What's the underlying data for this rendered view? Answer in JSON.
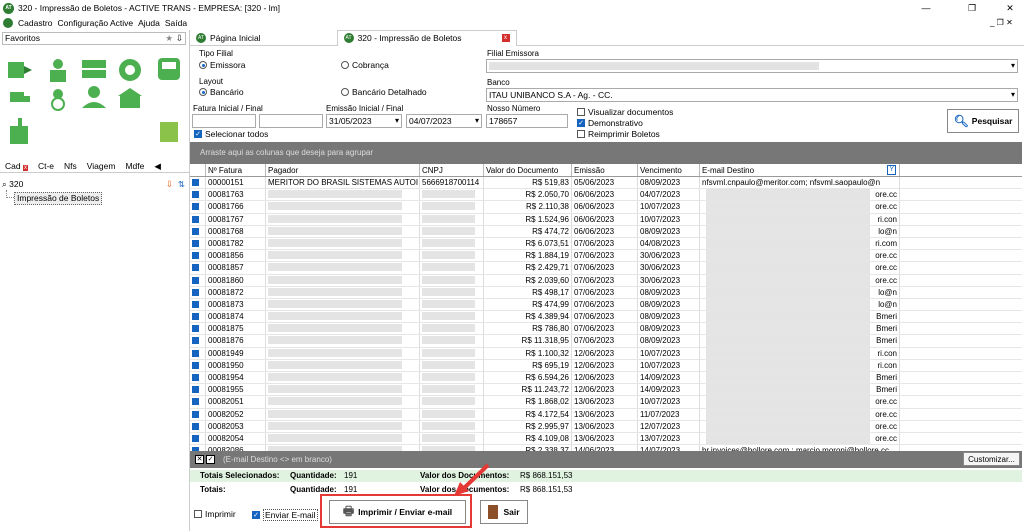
{
  "window": {
    "title": "320 - Impressão de Boletos - ACTIVE TRANS - EMPRESA: [320 - lm]",
    "logo": "AT"
  },
  "menu": [
    "Cadastro",
    "Configuração Active",
    "Ajuda",
    "Saída"
  ],
  "left": {
    "favorites_label": "Favoritos",
    "tabs": [
      "Cad",
      "Ct-e",
      "Nfs",
      "Viagem",
      "Mdfe"
    ],
    "search_value": "320",
    "tree_item": "Impressão de Boletos"
  },
  "tabs": [
    {
      "label": "Página Inicial"
    },
    {
      "label": "320 - Impressão de Boletos"
    }
  ],
  "form": {
    "tipo_filial_label": "Tipo Filial",
    "emissora": "Emissora",
    "cobranca": "Cobrança",
    "layout_label": "Layout",
    "bancario": "Bancário",
    "bancario_detalhado": "Bancário Detalhado",
    "filial_emissora_label": "Filial Emissora",
    "banco_label": "Banco",
    "banco_value": "ITAU UNIBANCO S.A - Ag.        - CC.",
    "fatura_label": "Fatura Inicial / Final",
    "emissao_label": "Emissão Inicial / Final",
    "emissao_inicial": "31/05/2023",
    "emissao_final": "04/07/2023",
    "nosso_numero_label": "Nosso Número",
    "nosso_numero": "178657",
    "visualizar": "Visualizar documentos",
    "demonstrativo": "Demonstrativo",
    "reimprimir": "Reimprimir Boletos",
    "selecionar_todos": "Selecionar todos",
    "pesquisar": "Pesquisar"
  },
  "grid": {
    "group_hint": "Arraste aqui as colunas que deseja para agrupar",
    "columns": [
      "Nº Fatura",
      "Pagador",
      "CNPJ",
      "Valor do Documento",
      "Emissão",
      "Vencimento",
      "E-mail Destino"
    ],
    "rows": [
      [
        "00000151",
        "MERITOR DO BRASIL SISTEMAS AUTOI",
        "5666918700114",
        "R$ 519,83",
        "05/06/2023",
        "08/09/2023",
        "nfsvml.cnpaulo@meritor.com; nfsvml.saopaulo@n"
      ],
      [
        "00081763",
        "",
        "",
        "R$ 2.050,70",
        "06/06/2023",
        "04/07/2023",
        "ore.cc"
      ],
      [
        "00081766",
        "",
        "",
        "R$ 2.110,38",
        "06/06/2023",
        "10/07/2023",
        "ore.cc"
      ],
      [
        "00081767",
        "",
        "",
        "R$ 1.524,96",
        "06/06/2023",
        "10/07/2023",
        "ri.con"
      ],
      [
        "00081768",
        "",
        "",
        "R$ 474,72",
        "06/06/2023",
        "08/09/2023",
        "lo@n"
      ],
      [
        "00081782",
        "",
        "",
        "R$ 6.073,51",
        "07/06/2023",
        "04/08/2023",
        "ri.com"
      ],
      [
        "00081856",
        "",
        "",
        "R$ 1.884,19",
        "07/06/2023",
        "30/06/2023",
        "ore.cc"
      ],
      [
        "00081857",
        "",
        "",
        "R$ 2.429,71",
        "07/06/2023",
        "30/06/2023",
        "ore.cc"
      ],
      [
        "00081860",
        "",
        "",
        "R$ 2.039,60",
        "07/06/2023",
        "30/06/2023",
        "ore.cc"
      ],
      [
        "00081872",
        "",
        "",
        "R$ 498,17",
        "07/06/2023",
        "08/09/2023",
        "lo@n"
      ],
      [
        "00081873",
        "",
        "",
        "R$ 474,99",
        "07/06/2023",
        "08/09/2023",
        "lo@n"
      ],
      [
        "00081874",
        "",
        "",
        "R$ 4.389,94",
        "07/06/2023",
        "08/09/2023",
        "Bmeri"
      ],
      [
        "00081875",
        "",
        "",
        "R$ 786,80",
        "07/06/2023",
        "08/09/2023",
        "Bmeri"
      ],
      [
        "00081876",
        "",
        "",
        "R$ 11.318,95",
        "07/06/2023",
        "08/09/2023",
        "Bmeri"
      ],
      [
        "00081949",
        "",
        "",
        "R$ 1.100,32",
        "12/06/2023",
        "10/07/2023",
        "ri.con"
      ],
      [
        "00081950",
        "",
        "",
        "R$ 695,19",
        "12/06/2023",
        "10/07/2023",
        "ri.con"
      ],
      [
        "00081954",
        "",
        "",
        "R$ 6.594,26",
        "12/06/2023",
        "14/09/2023",
        "Bmeri"
      ],
      [
        "00081955",
        "",
        "",
        "R$ 11.243,72",
        "12/06/2023",
        "14/09/2023",
        "Bmeri"
      ],
      [
        "00082051",
        "",
        "",
        "R$ 1.868,02",
        "13/06/2023",
        "10/07/2023",
        "ore.cc"
      ],
      [
        "00082052",
        "",
        "",
        "R$ 4.172,54",
        "13/06/2023",
        "11/07/2023",
        "ore.cc"
      ],
      [
        "00082053",
        "",
        "",
        "R$ 2.995,97",
        "13/06/2023",
        "12/07/2023",
        "ore.cc"
      ],
      [
        "00082054",
        "",
        "",
        "R$ 4.109,08",
        "13/06/2023",
        "13/07/2023",
        "ore.cc"
      ],
      [
        "00082086",
        "",
        "",
        "R$ 2.338,37",
        "14/06/2023",
        "14/07/2023",
        "br.invoices@bollore.com ; marcio.moroni@bollore.cc"
      ]
    ],
    "filter_text": "(E-mail Destino <> em branco)",
    "customize": "Customizar..."
  },
  "totals": {
    "selected_label": "Totais Selecionados:",
    "total_label": "Totais:",
    "quantidade_label": "Quantidade:",
    "quantidade_sel": "191",
    "quantidade_tot": "191",
    "valor_label": "Valor dos Documentos:",
    "valor_sel": "R$ 868.151,53",
    "valor_tot": "R$ 868.151,53"
  },
  "footer": {
    "imprimir": "Imprimir",
    "enviar_email": "Enviar E-mail",
    "imprimir_enviar": "Imprimir / Enviar e-mail",
    "sair": "Sair"
  }
}
